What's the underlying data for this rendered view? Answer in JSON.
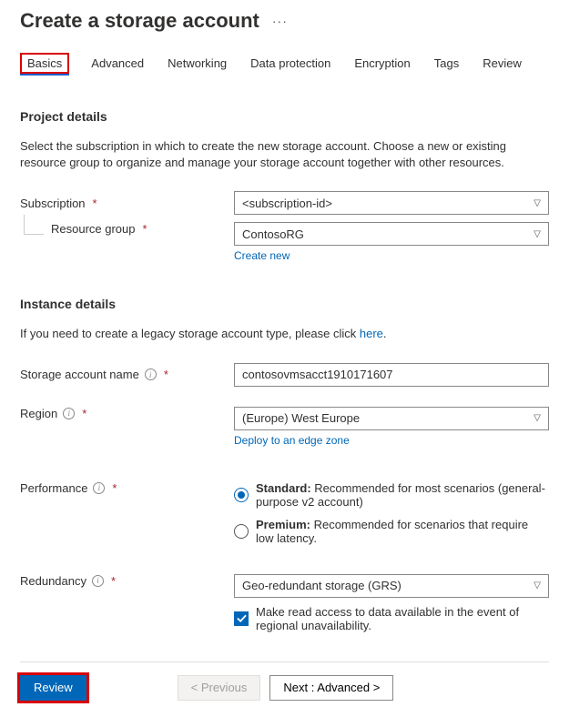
{
  "header": {
    "title": "Create a storage account",
    "more": "···"
  },
  "tabs": {
    "basics": "Basics",
    "advanced": "Advanced",
    "networking": "Networking",
    "dataprotection": "Data protection",
    "encryption": "Encryption",
    "tags": "Tags",
    "review": "Review"
  },
  "project": {
    "heading": "Project details",
    "desc": "Select the subscription in which to create the new storage account. Choose a new or existing resource group to organize and manage your storage account together with other resources.",
    "subscription_label": "Subscription",
    "subscription_value": "<subscription-id>",
    "rg_label": "Resource group",
    "rg_value": "ContosoRG",
    "create_new": "Create new"
  },
  "instance": {
    "heading": "Instance details",
    "legacy_pre": "If you need to create a legacy storage account type, please click ",
    "legacy_link": "here",
    "legacy_post": ".",
    "name_label": "Storage account name",
    "name_value": "contosovmsacct1910171607",
    "region_label": "Region",
    "region_value": "(Europe) West Europe",
    "deploy_edge": "Deploy to an edge zone",
    "performance_label": "Performance",
    "perf_std_b": "Standard:",
    "perf_std_rest": " Recommended for most scenarios (general-purpose v2 account)",
    "perf_prem_b": "Premium:",
    "perf_prem_rest": " Recommended for scenarios that require low latency.",
    "redundancy_label": "Redundancy",
    "redundancy_value": "Geo-redundant storage (GRS)",
    "ra_checkbox": "Make read access to data available in the event of regional unavailability."
  },
  "footer": {
    "review": "Review",
    "previous": "< Previous",
    "next": "Next : Advanced >"
  }
}
